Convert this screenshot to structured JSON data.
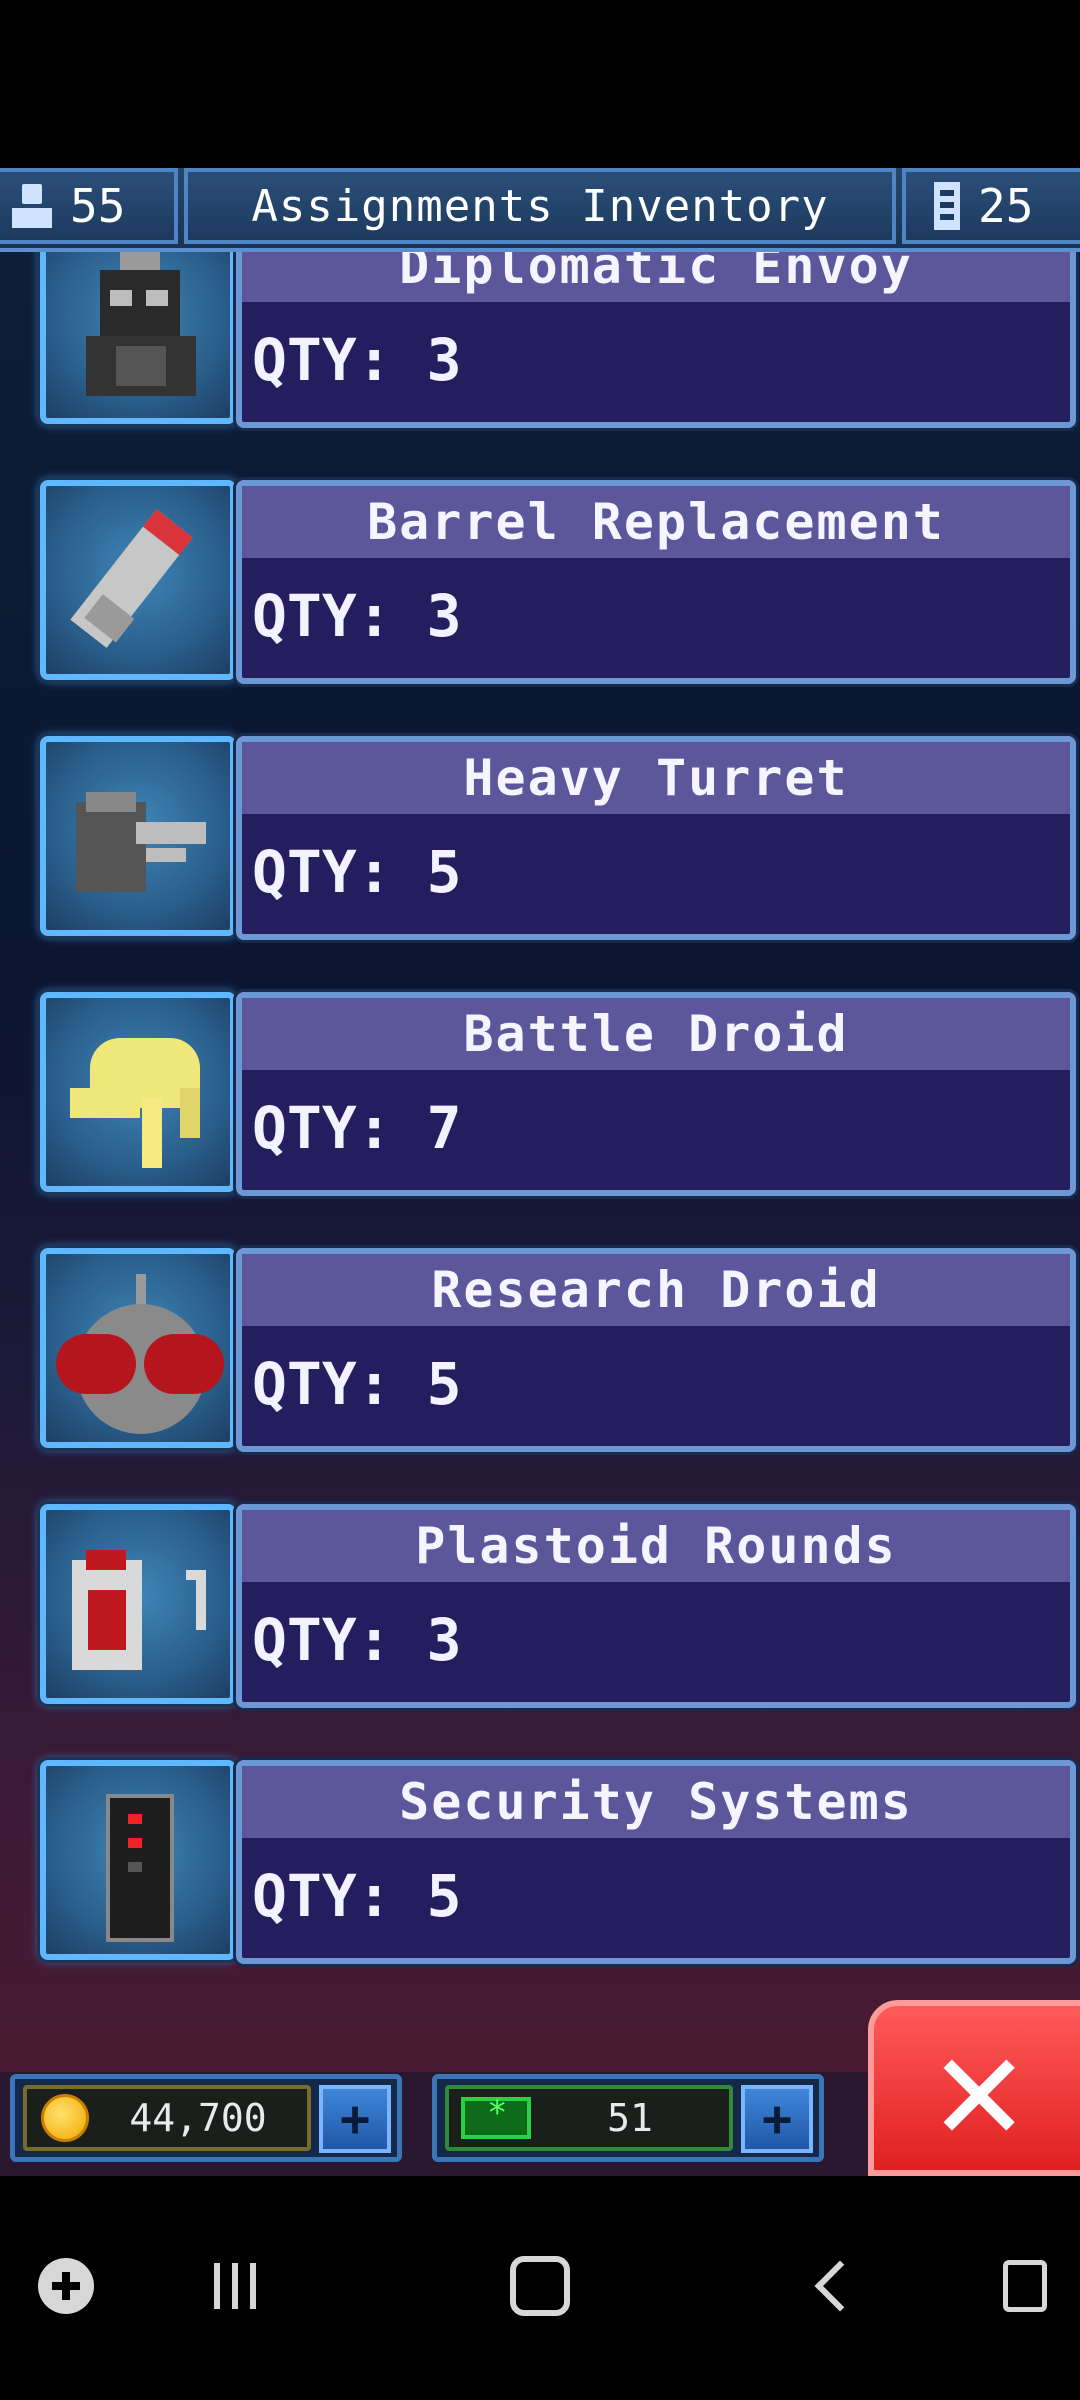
{
  "header": {
    "crew_count": "55",
    "title": "Assignments Inventory",
    "storage_count": "25"
  },
  "items": [
    {
      "name": "Diplomatic Envoy",
      "qty": "QTY: 3",
      "icon": "envoy-icon"
    },
    {
      "name": "Barrel Replacement",
      "qty": "QTY: 3",
      "icon": "barrel-icon"
    },
    {
      "name": "Heavy Turret",
      "qty": "QTY: 5",
      "icon": "turret-icon"
    },
    {
      "name": "Battle Droid",
      "qty": "QTY: 7",
      "icon": "battle-droid-icon"
    },
    {
      "name": "Research Droid",
      "qty": "QTY: 5",
      "icon": "research-droid-icon"
    },
    {
      "name": "Plastoid Rounds",
      "qty": "QTY: 3",
      "icon": "plastoid-rounds-icon"
    },
    {
      "name": "Security Systems",
      "qty": "QTY: 5",
      "icon": "security-systems-icon"
    }
  ],
  "resources": {
    "credits": "44,700",
    "gems": "51"
  },
  "colors": {
    "card_bg": "#251e5e",
    "card_title_bg": "#5c569b",
    "frame": "#5fb7ff",
    "close": "#e02020"
  }
}
